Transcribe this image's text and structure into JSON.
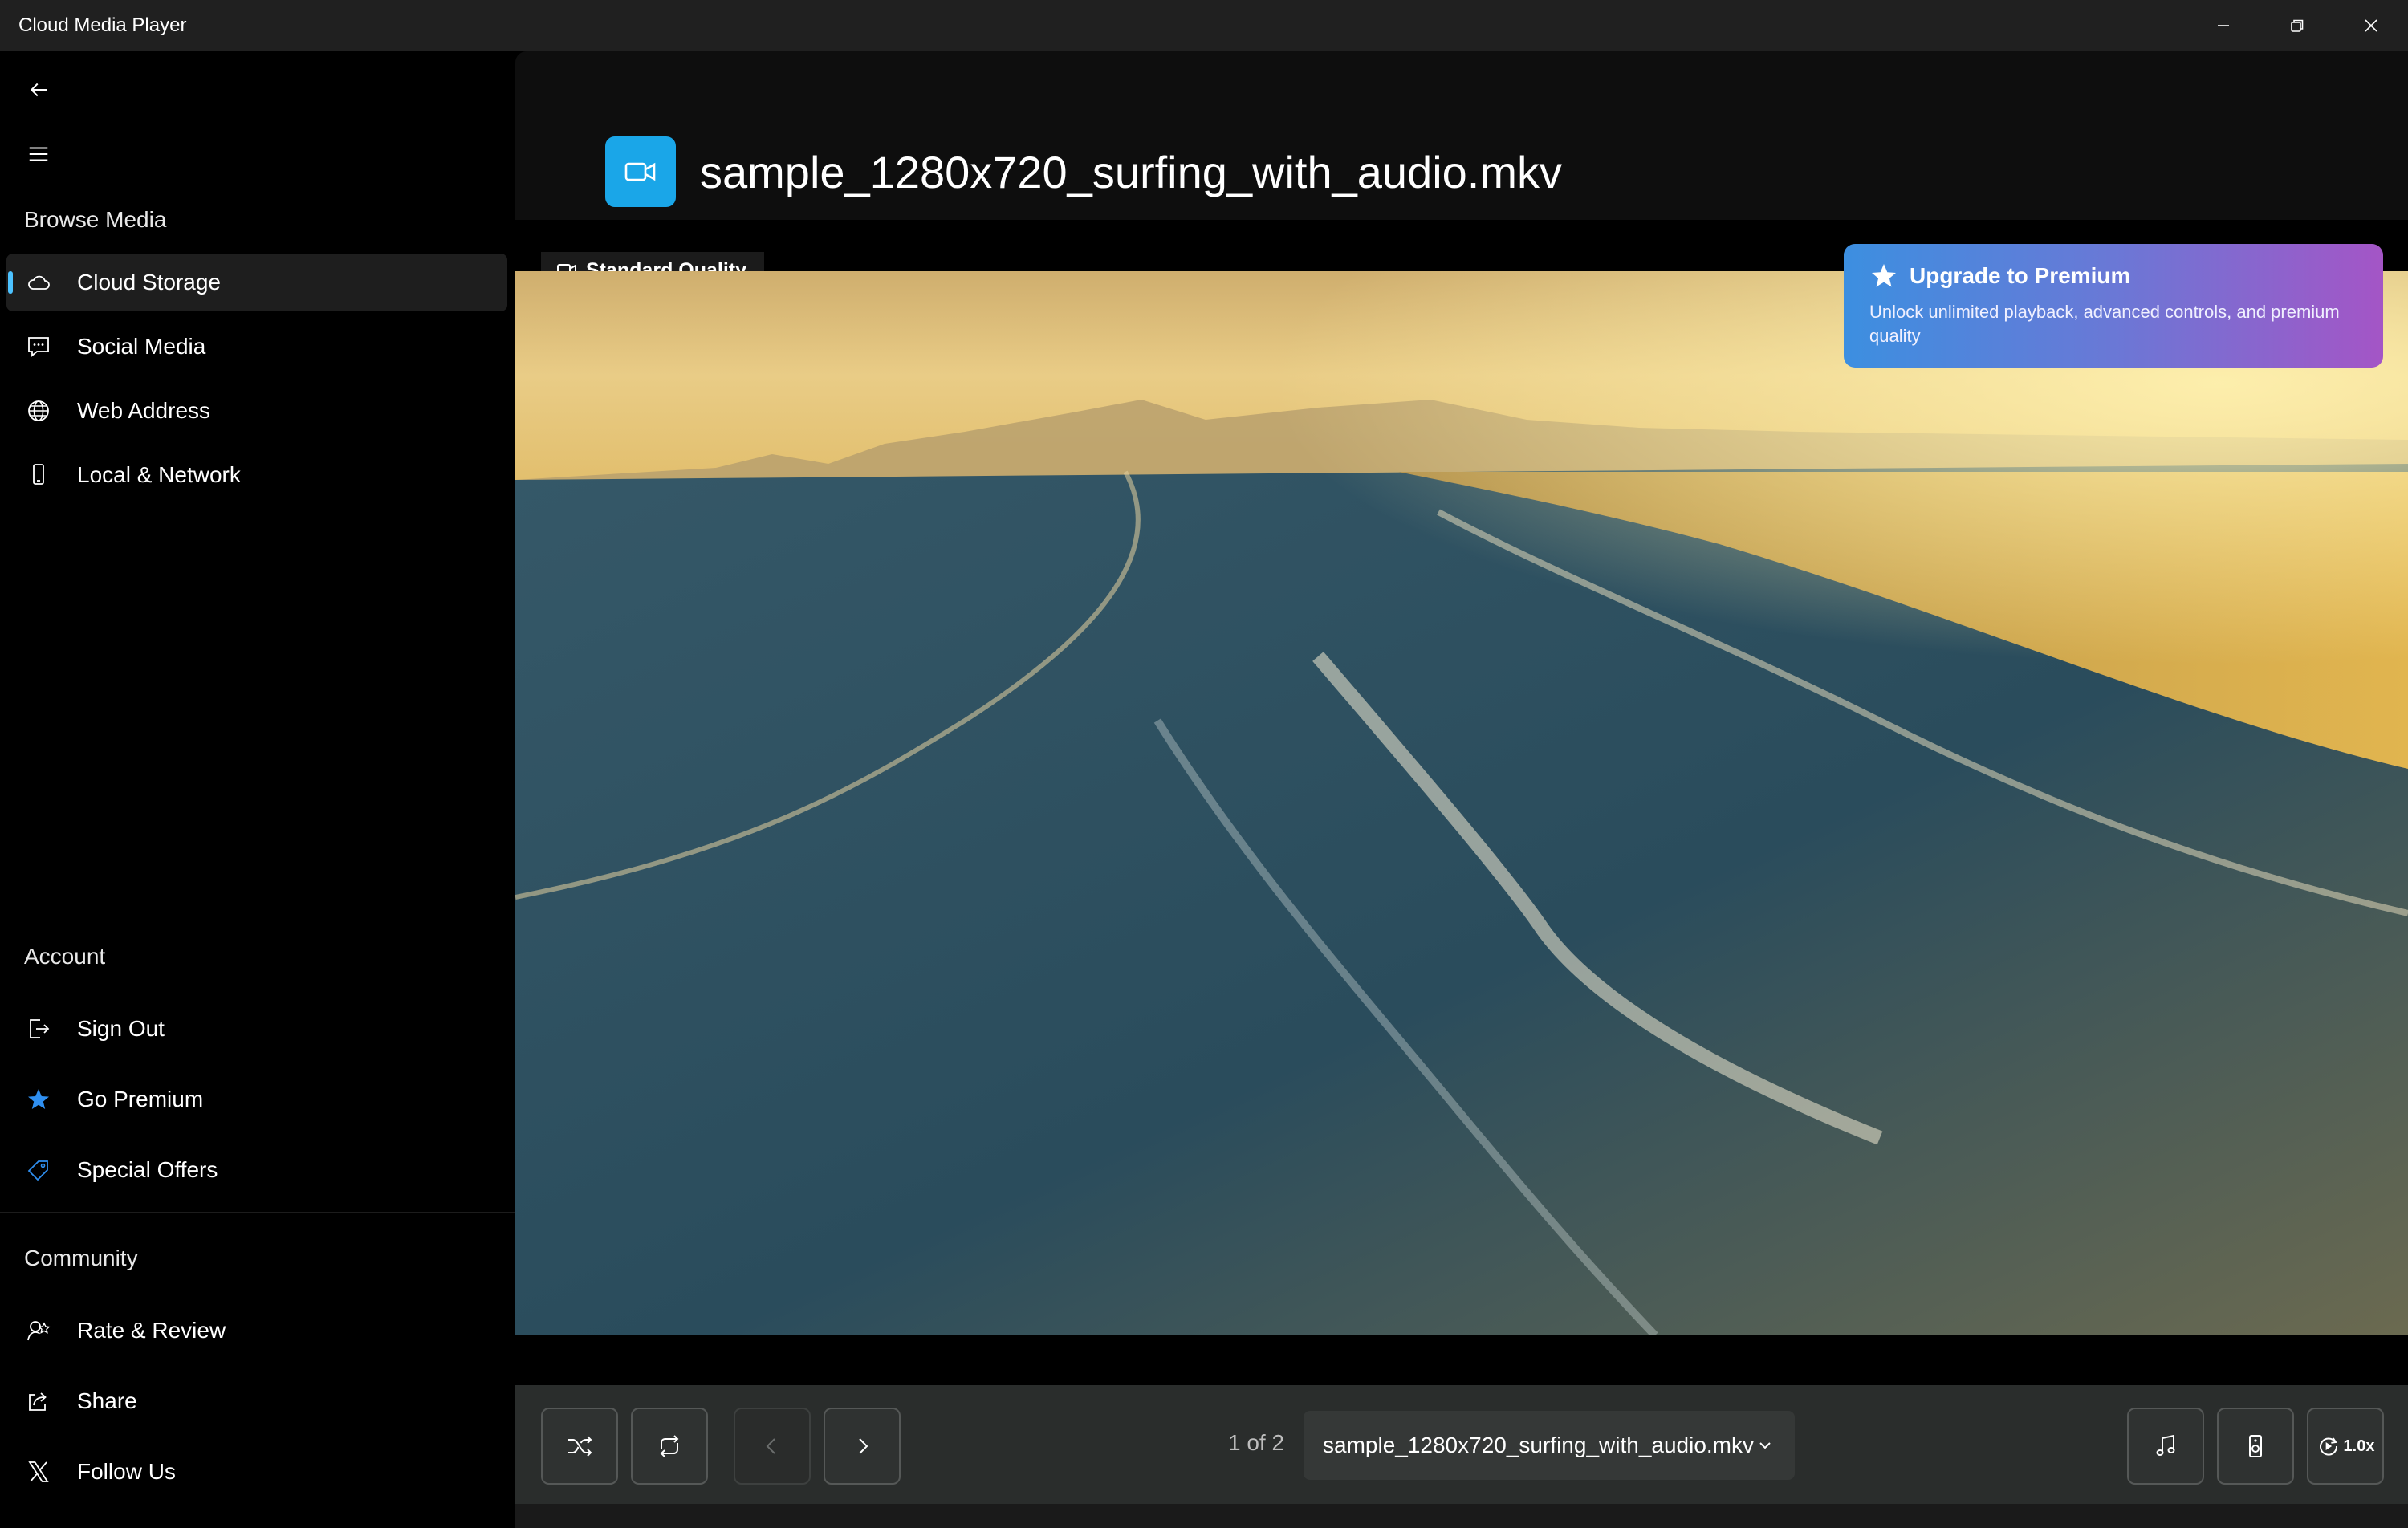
{
  "window": {
    "title": "Cloud Media Player",
    "controls": [
      "minimize-icon",
      "restore-icon",
      "close-icon"
    ]
  },
  "sidebar": {
    "browse_label": "Browse Media",
    "browse_items": [
      {
        "label": "Cloud Storage",
        "icon": "cloud-icon",
        "active": true
      },
      {
        "label": "Social Media",
        "icon": "chat-icon",
        "active": false
      },
      {
        "label": "Web Address",
        "icon": "globe-icon",
        "active": false
      },
      {
        "label": "Local & Network",
        "icon": "phone-icon",
        "active": false
      }
    ],
    "account_label": "Account",
    "account_items": [
      {
        "label": "Sign Out",
        "icon": "sign-out-icon"
      },
      {
        "label": "Go Premium",
        "icon": "star-icon"
      },
      {
        "label": "Special Offers",
        "icon": "tag-icon"
      }
    ],
    "community_label": "Community",
    "community_items": [
      {
        "label": "Rate & Review",
        "icon": "rate-review-icon"
      },
      {
        "label": "Share",
        "icon": "share-icon"
      },
      {
        "label": "Follow Us",
        "icon": "x-logo-icon"
      }
    ]
  },
  "main": {
    "file_title": "sample_1280x720_surfing_with_audio.mkv",
    "quality_badge": "Standard Quality",
    "premium": {
      "title": "Upgrade to Premium",
      "description": "Unlock unlimited playback, advanced controls, and premium quality"
    },
    "player": {
      "count": "1 of 2",
      "selected_file": "sample_1280x720_surfing_with_audio.mkv",
      "speed": "1.0x"
    }
  },
  "colors": {
    "accent": "#4cc2ff",
    "file_icon_bg": "#1aa6e8",
    "premium_gradient_start": "#3c8fe0",
    "premium_gradient_end": "#a455c6"
  }
}
